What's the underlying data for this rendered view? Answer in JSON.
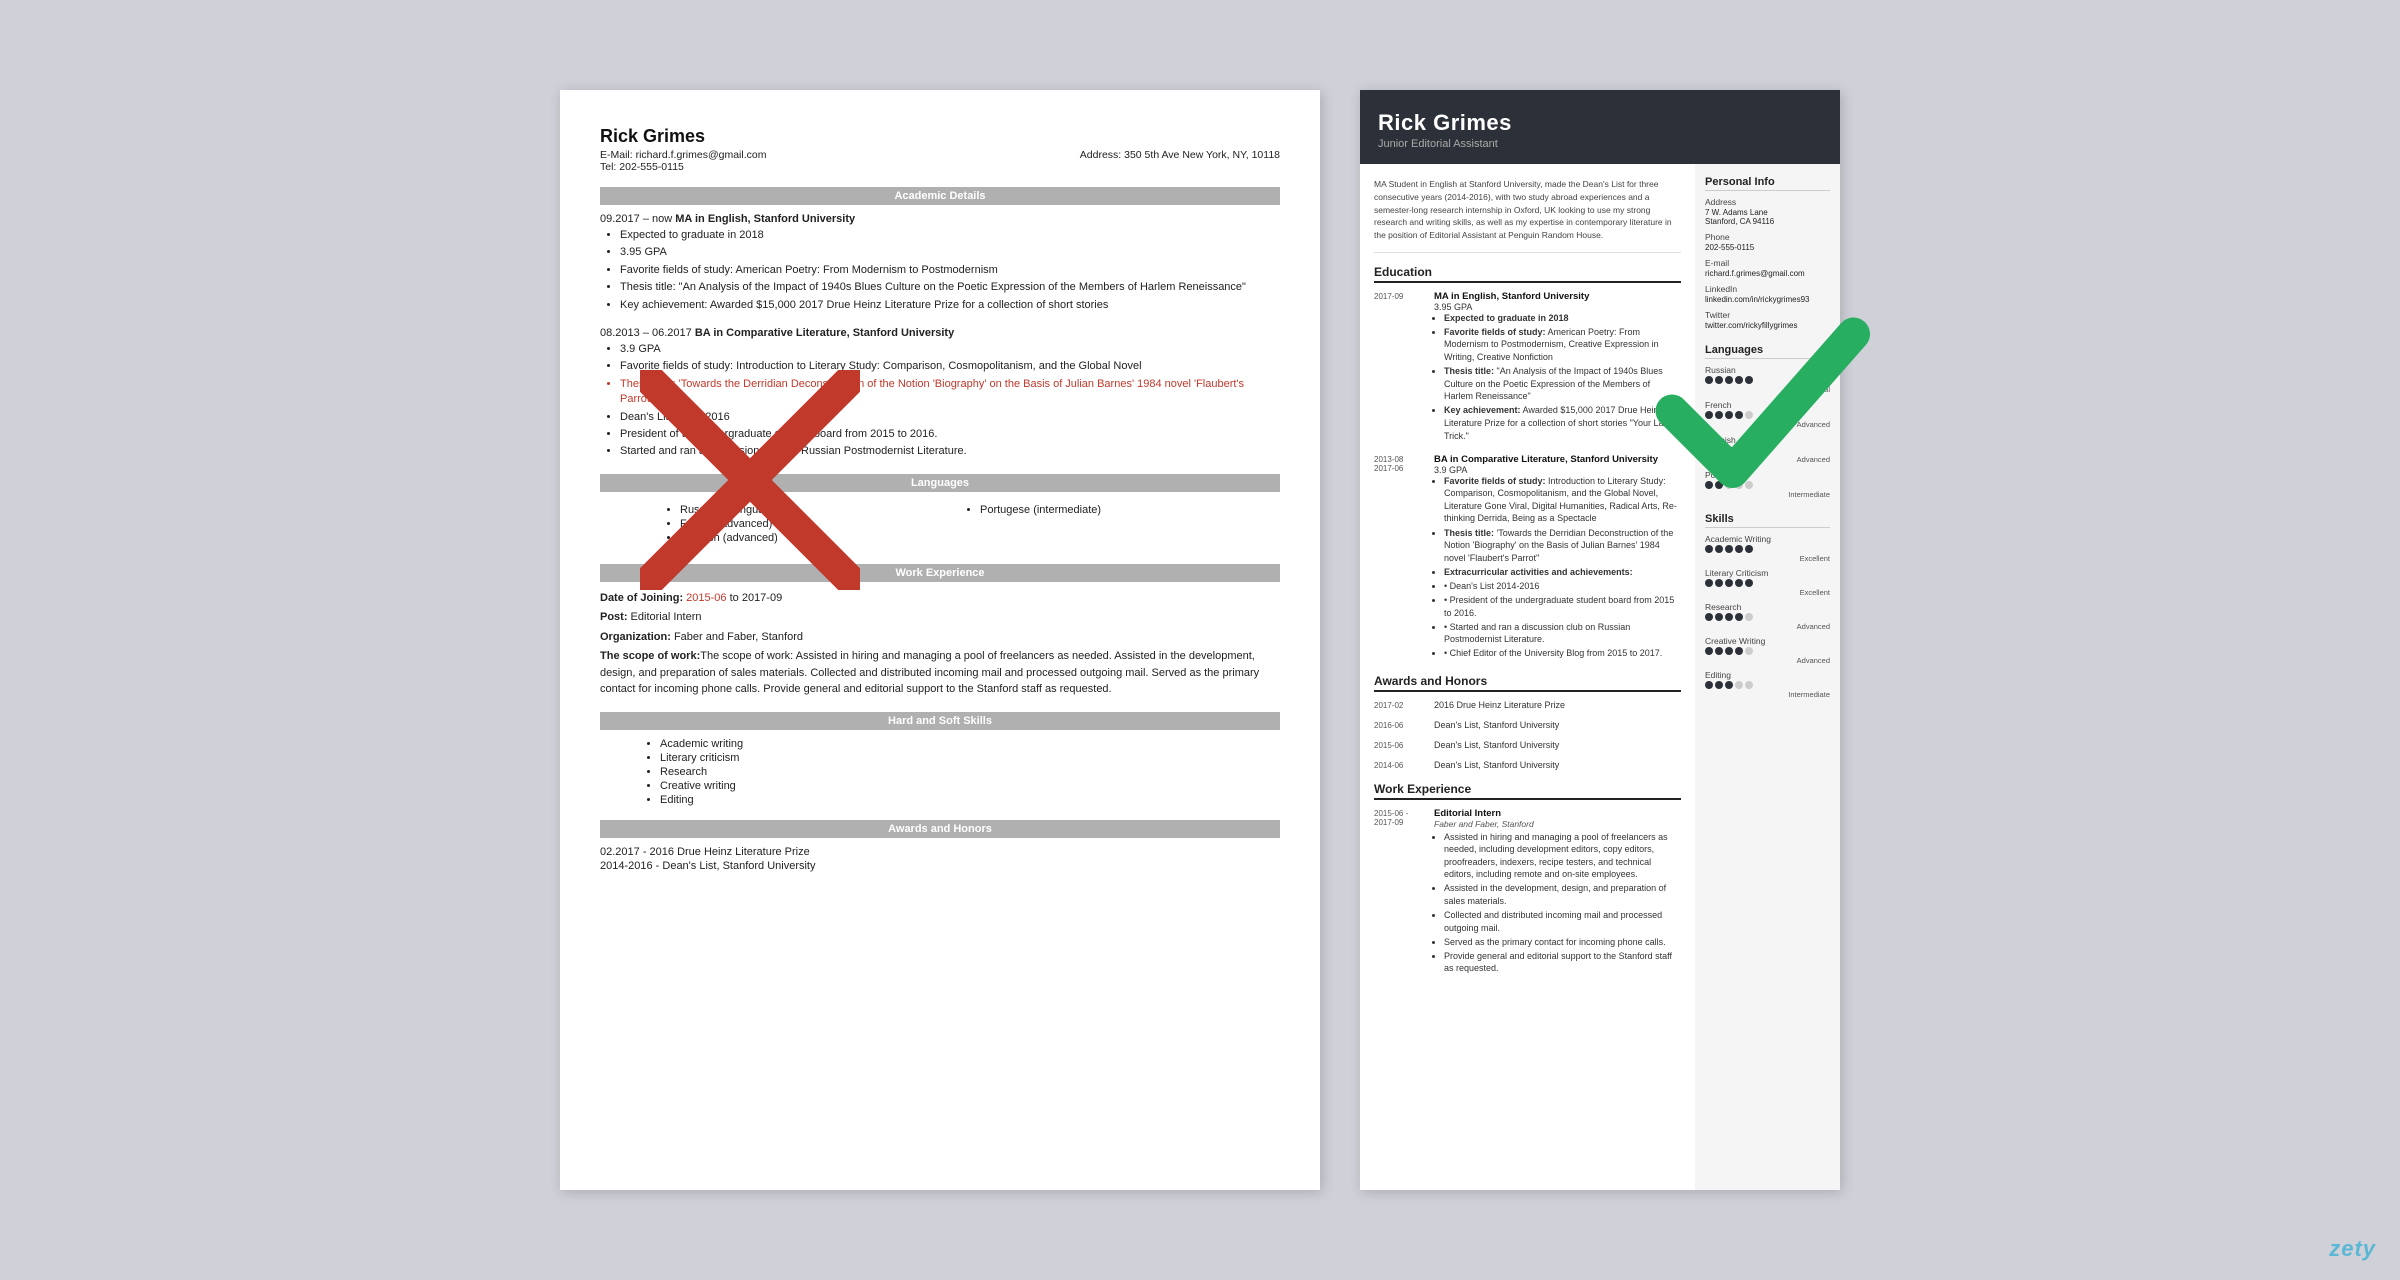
{
  "classic": {
    "name": "Rick Grimes",
    "email_label": "E-Mail:",
    "email": "richard.f.grimes@gmail.com",
    "address_label": "Address:",
    "address": "350 5th Ave New York, NY, 10118",
    "tel_label": "Tel:",
    "tel": "202-555-0115",
    "sections": {
      "academic_details": "Academic Details",
      "languages": "Languages",
      "work_experience": "Work Experience",
      "hard_soft_skills": "Hard and Soft Skills",
      "awards_honors": "Awards and Honors"
    },
    "education": [
      {
        "date": "09.2017 – now",
        "degree": "MA in English, Stanford University",
        "bullets": [
          "Expected to graduate in 2018",
          "3.95 GPA",
          "Favorite fields of study: American Poetry: From Modernism to Postmodernism",
          "Thesis title: \"An Analysis of the Impact of 1940s Blues Culture on the Poetic Expression of the Members of Harlem Reneissance\"",
          "Key achievement: Awarded $15,000 2017 Drue Heinz Literature Prize for a collection of short stories"
        ]
      },
      {
        "date": "08.2013 – 06.2017",
        "degree": "BA in Comparative Literature, Stanford University",
        "bullets": [
          "3.9 GPA",
          "Favorite fields of study: Introduction to Literary Study: Comparison, Cosmopolitanism, and the Global Novel",
          "Thesis title: 'Towards the Derridian Deconstruction of the Notion 'Biography' on the Basis of Julian Barnes' 1984 novel 'Flaubert's Parrot''",
          "Dean's List 2014-2016",
          "President of the undergraduate student board from 2015 to 2016.",
          "Started and ran a discussion club on Russian Postmodernist Literature."
        ]
      }
    ],
    "langs_col1": [
      "Russian (bilingual)",
      "French (advanced)",
      "Spanish (advanced)"
    ],
    "langs_col2": [
      "Portugese (intermediate)"
    ],
    "work": {
      "date": "Date of Joining: 2015-06 to 2017-09",
      "post": "Post: Editorial Intern",
      "org": "Organization: Faber and Faber, Stanford",
      "scope": "The scope of work: Assisted in hiring and managing a pool of freelancers as needed. Assisted in the development, design, and preparation of sales materials. Collected and distributed incoming mail and processed outgoing mail. Served as the primary contact for incoming phone calls. Provide general and editorial support to the Stanford staff as requested."
    },
    "skills": [
      "Academic writing",
      "Literary criticism",
      "Research",
      "Creative writing",
      "Editing"
    ],
    "awards": [
      "02.2017 - 2016 Drue Heinz Literature Prize",
      "2014-2016 - Dean's List, Stanford University"
    ]
  },
  "modern": {
    "name": "Rick Grimes",
    "title": "Junior Editorial Assistant",
    "summary": "MA Student in English at Stanford University, made the Dean's List for three consecutive years (2014-2016), with two study abroad experiences and a semester-long research internship in Oxford, UK looking to use my strong research and writing skills, as well as my expertise in contemporary literature in the position of Editorial Assistant at Penguin Random House.",
    "sections": {
      "education": "Education",
      "awards": "Awards and Honors",
      "work": "Work Experience"
    },
    "education": [
      {
        "date_start": "2017-09",
        "date_end": "",
        "degree": "MA in English, Stanford University",
        "gpa": "3.95 GPA",
        "bullets": [
          "Expected to graduate in 2018",
          "Favorite fields of study: American Poetry: From Modernism to Postmodernism, Creative Expression in Writing, Creative Nonfiction",
          "Thesis title: \"An Analysis of the Impact of 1940s Blues Culture on the Poetic Expression of the Members of Harlem Reneissance\"",
          "Key achievement: Awarded $15,000 2017 Drue Heinz Literature Prize for a collection of short stories \"Your Latest Trick.\""
        ]
      },
      {
        "date_start": "2013-08",
        "date_end": "2017-06",
        "degree": "BA in Comparative Literature, Stanford University",
        "gpa": "3.9 GPA",
        "bullets": [
          "Favorite fields of study: Introduction to Literary Study: Comparison, Cosmopolitanism, and the Global Novel, Literature Gone Viral, Digital Humanities, Radical Arts, Re-thinking Derrida, Being as a Spectacle",
          "Thesis title: 'Towards the Derridian Deconstruction of the Notion 'Biography' on the Basis of Julian Barnes' 1984 novel 'Flaubert's Parrot''",
          "Extracurricular activities and achievements:",
          "Dean's List 2014-2016",
          "President of the undergraduate student board from 2015 to 2016.",
          "Started and ran a discussion club on Russian Postmodernist Literature.",
          "Chief Editor of the University Blog from 2015 to 2017."
        ]
      }
    ],
    "awards": [
      {
        "date": "2017-02",
        "title": "2016 Drue Heinz Literature Prize"
      },
      {
        "date": "2016-06",
        "title": "Dean's List, Stanford University"
      },
      {
        "date": "2015-06",
        "title": "Dean's List, Stanford University"
      },
      {
        "date": "2014-06",
        "title": "Dean's List, Stanford University"
      }
    ],
    "work": [
      {
        "date_start": "2015-06 -",
        "date_end": "2017-09",
        "title": "Editorial Intern",
        "org": "Faber and Faber, Stanford",
        "bullets": [
          "Assisted in hiring and managing a pool of freelancers as needed, including development editors, copy editors, proofreaders, indexers, recipe testers, and technical editors, including remote and on-site employees.",
          "Assisted in the development, design, and preparation of sales materials.",
          "Collected and distributed incoming mail and processed outgoing mail.",
          "Served as the primary contact for incoming phone calls.",
          "Provide general and editorial support to the Stanford staff as requested."
        ]
      }
    ],
    "sidebar": {
      "personal_info_title": "Personal Info",
      "address_label": "Address",
      "address": "7 W. Adams Lane\nStanford, CA 94116",
      "phone_label": "Phone",
      "phone": "202-555-0115",
      "email_label": "E-mail",
      "email": "richard.f.grimes@gmail.com",
      "linkedin_label": "LinkedIn",
      "linkedin": "linkedin.com/in/rickygrimes93",
      "twitter_label": "Twitter",
      "twitter": "twitter.com/rickyfillygrimes",
      "languages_title": "Languages",
      "langs": [
        {
          "name": "Russian",
          "dots": 5,
          "filled": 5,
          "level": "Bilingual"
        },
        {
          "name": "French",
          "dots": 5,
          "filled": 4,
          "level": "Advanced"
        },
        {
          "name": "Spanish",
          "dots": 5,
          "filled": 4,
          "level": "Advanced"
        },
        {
          "name": "Portugese",
          "dots": 5,
          "filled": 2,
          "level": "Intermediate"
        }
      ],
      "skills_title": "Skills",
      "skills": [
        {
          "name": "Academic Writing",
          "dots": 5,
          "filled": 5,
          "level": "Excellent"
        },
        {
          "name": "Literary Criticism",
          "dots": 5,
          "filled": 5,
          "level": "Excellent"
        },
        {
          "name": "Research",
          "dots": 5,
          "filled": 4,
          "level": "Advanced"
        },
        {
          "name": "Creative Writing",
          "dots": 5,
          "filled": 4,
          "level": "Advanced"
        },
        {
          "name": "Editing",
          "dots": 5,
          "filled": 3,
          "level": "Intermediate"
        }
      ]
    }
  },
  "zety": "zety"
}
